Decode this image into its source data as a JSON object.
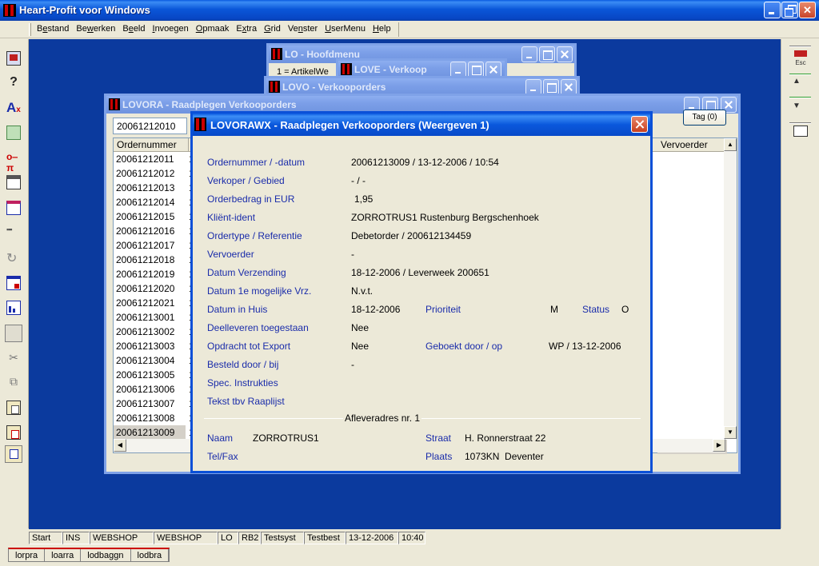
{
  "app": {
    "title": "Heart-Profit voor Windows"
  },
  "menu": [
    {
      "label": "Bestand",
      "ul": "e"
    },
    {
      "label": "Bewerken",
      "ul": "w"
    },
    {
      "label": "Beeld",
      "ul": "e"
    },
    {
      "label": "Invoegen",
      "ul": "I"
    },
    {
      "label": "Opmaak",
      "ul": "O"
    },
    {
      "label": "Extra",
      "ul": "x"
    },
    {
      "label": "Grid",
      "ul": "G"
    },
    {
      "label": "Venster",
      "ul": "n"
    },
    {
      "label": "UserMenu",
      "ul": "U"
    },
    {
      "label": "Help",
      "ul": "H"
    }
  ],
  "left_toolbar_icons": [
    "screen-icon",
    "help-icon",
    "font-icon",
    "export-icon",
    "key-icon",
    "print-icon",
    "form-icon",
    "grid-icon",
    "refresh-icon",
    "window-icon",
    "chart-icon",
    "blank-icon",
    "cut-icon",
    "copy-icon",
    "paste-icon",
    "paste-special-icon",
    "edit-icon"
  ],
  "right_toolbar": {
    "esc_label": "Esc"
  },
  "windows": {
    "lo": {
      "title": "LO - Hoofdmenu",
      "snippet": "1 = ArtikelWe"
    },
    "love": {
      "title": "LOVE - Verkoop"
    },
    "lovo": {
      "title": "LOVO - Verkooporders"
    },
    "lovora": {
      "title": "LOVORA - Raadplegen Verkooporders",
      "search_value": "20061212010",
      "tag_button": "Tag (0)",
      "columns": {
        "ordernummer": "Ordernummer",
        "vervoerder": "Vervoerder"
      },
      "rows": [
        "20061212011",
        "20061212012",
        "20061212013",
        "20061212014",
        "20061212015",
        "20061212016",
        "20061212017",
        "20061212018",
        "20061212019",
        "20061212020",
        "20061212021",
        "20061213001",
        "20061213002",
        "20061213003",
        "20061213004",
        "20061213005",
        "20061213006",
        "20061213007",
        "20061213008",
        "20061213009"
      ],
      "row_tail": "1",
      "selected_row": "20061213009"
    }
  },
  "dialog": {
    "title": "LOVORAWX - Raadplegen Verkooporders (Weergeven 1)",
    "fields": {
      "ordernummer_label": "Ordernummer / -datum",
      "ordernummer_value": "20061213009 / 13-12-2006 / 10:54",
      "verkoper_label": "Verkoper / Gebied",
      "verkoper_value": "- / -",
      "orderbedrag_label": "Orderbedrag in EUR",
      "orderbedrag_value": "1,95",
      "klient_label": "Kliënt-ident",
      "klient_value": "ZORROTRUS1 Rustenburg Bergschenhoek",
      "ordertype_label": "Ordertype / Referentie",
      "ordertype_value": "Debetorder / 200612134459",
      "vervoerder_label": "Vervoerder",
      "vervoerder_value": "-",
      "datum_verzending_label": "Datum Verzending",
      "datum_verzending_value": "18-12-2006 / Leverweek 200651",
      "datum_1e_label": "Datum 1e mogelijke Vrz.",
      "datum_1e_value": "N.v.t.",
      "datum_huis_label": "Datum in Huis",
      "datum_huis_value": "18-12-2006",
      "prioriteit_label": "Prioriteit",
      "prioriteit_value": "M",
      "status_label": "Status",
      "status_value": "O",
      "deelleveren_label": "Deelleveren toegestaan",
      "deelleveren_value": "Nee",
      "export_label": "Opdracht tot Export",
      "export_value": "Nee",
      "geboekt_label": "Geboekt door / op",
      "geboekt_value": "WP / 13-12-2006",
      "besteld_label": "Besteld door / bij",
      "besteld_value": "-",
      "spec_label": "Spec. Instrukties",
      "tekst_label": "Tekst tbv Raaplijst",
      "afleveradres_heading": "Afleveradres nr. 1",
      "naam_label": "Naam",
      "naam_value": "ZORROTRUS1",
      "straat_label": "Straat",
      "straat_value": "H. Ronnerstraat 22",
      "telfax_label": "Tel/Fax",
      "plaats_label": "Plaats",
      "plaats_value": "1073KN  Deventer"
    }
  },
  "statusbar": [
    "Start",
    "INS",
    "WEBSHOP",
    "WEBSHOP",
    "LO",
    "RB2",
    "Testsyst",
    "Testbest",
    "13-12-2006",
    "10:40"
  ],
  "taskbar": [
    "lorpra",
    "loarra",
    "lodbaggn",
    "lodbra"
  ],
  "colors": {
    "workspace": "#0b3a9e",
    "label_blue": "#1a2caa",
    "active_title": "#0a58dc"
  }
}
